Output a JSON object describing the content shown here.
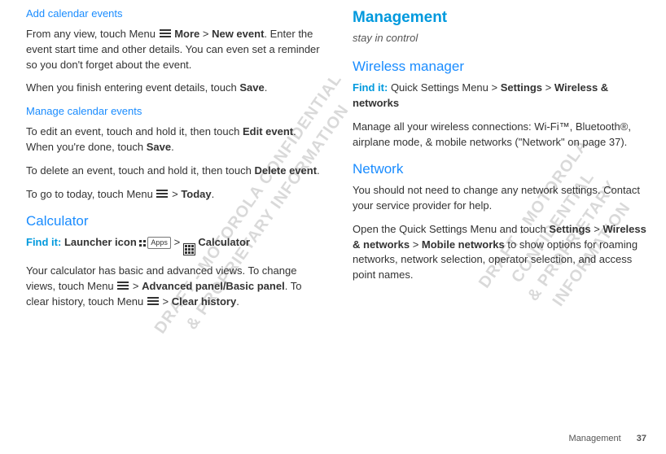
{
  "watermark": "DRAFT - MOTOROLA CONFIDENTIAL\n& PROPRIETARY INFORMATION",
  "left": {
    "sec1_title": "Add calendar events",
    "sec1_p1a": "From any view, touch Menu ",
    "sec1_more": "More",
    "sec1_gt": " > ",
    "sec1_newevent": "New event",
    "sec1_p1b": ". Enter the event start time and other details. You can even set a reminder so you don't forget about the event.",
    "sec1_p2a": "When you finish entering event details, touch ",
    "sec1_save": "Save",
    "sec1_p2b": ".",
    "sec2_title": "Manage calendar events",
    "sec2_p1a": "To edit an event, touch and hold it, then touch ",
    "sec2_edit": "Edit event",
    "sec2_p1b": ". When you're done, touch ",
    "sec2_save": "Save",
    "sec2_p1c": ".",
    "sec2_p2a": "To delete an event, touch and hold it, then touch ",
    "sec2_delete": "Delete event",
    "sec2_p2b": ".",
    "sec2_p3a": "To go to today, touch Menu ",
    "sec2_today": "Today",
    "sec2_p3b": ".",
    "calc_title": "Calculator",
    "calc_findit": "Find it: ",
    "calc_launcher": "Launcher icon",
    "calc_apps": "Apps",
    "calc_calc": "Calculator",
    "calc_p1a": "Your calculator has basic and advanced views. To change views, touch Menu ",
    "calc_adv": "Advanced panel/Basic panel",
    "calc_p1b": ". To clear history, touch Menu ",
    "calc_clear": "Clear history",
    "calc_p1c": "."
  },
  "right": {
    "h1": "Management",
    "sub": "stay in control",
    "wm_title": "Wireless manager",
    "wm_findit": "Find it: ",
    "wm_path1": "Quick Settings Menu > ",
    "wm_settings": "Settings",
    "wm_gt": " > ",
    "wm_wireless": "Wireless & networks",
    "wm_p1": "Manage all your wireless connections: Wi-Fi™, Bluetooth®, airplane mode, & mobile networks (\"Network\" on page 37).",
    "net_title": "Network",
    "net_p1": "You should not need to change any network settings. Contact your service provider for help.",
    "net_p2a": "Open the Quick Settings Menu and touch ",
    "net_settings": "Settings",
    "net_p2b": " > ",
    "net_wireless": "Wireless & networks",
    "net_p2c": " > ",
    "net_mobile": "Mobile networks",
    "net_p2d": " to show options for roaming networks, network selection, operator selection, and access point names."
  },
  "footer": {
    "section": "Management",
    "page": "37"
  }
}
